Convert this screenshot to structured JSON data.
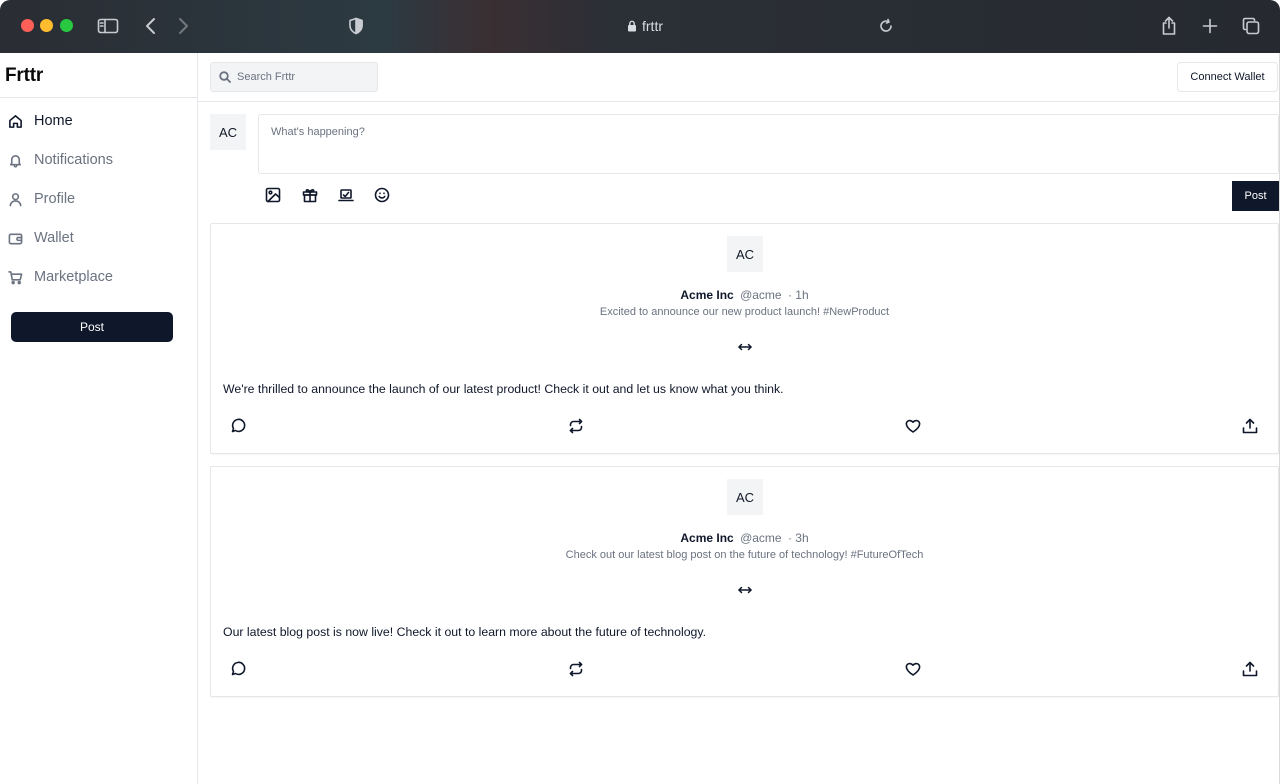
{
  "browser": {
    "url": "frttr",
    "icons": [
      "sidebar-toggle-icon",
      "back-icon",
      "forward-icon",
      "shield-icon",
      "lock-icon",
      "reload-icon",
      "share-icon",
      "new-tab-icon",
      "tabs-icon"
    ]
  },
  "sidebar": {
    "brand": "Frttr",
    "items": [
      {
        "label": "Home",
        "icon": "home-icon",
        "active": true
      },
      {
        "label": "Notifications",
        "icon": "bell-icon",
        "active": false
      },
      {
        "label": "Profile",
        "icon": "user-icon",
        "active": false
      },
      {
        "label": "Wallet",
        "icon": "wallet-icon",
        "active": false
      },
      {
        "label": "Marketplace",
        "icon": "cart-icon",
        "active": false
      }
    ],
    "post_button": "Post"
  },
  "header": {
    "search_placeholder": "Search Frttr",
    "connect_wallet": "Connect Wallet"
  },
  "composer": {
    "avatar": "AC",
    "placeholder": "What's happening?",
    "tools": [
      "image-icon",
      "gift-icon",
      "laptop-icon",
      "smile-icon"
    ],
    "post_button": "Post"
  },
  "posts": [
    {
      "avatar": "AC",
      "name": "Acme Inc",
      "handle": "@acme",
      "time": "· 1h",
      "subtitle": "Excited to announce our new product launch! #NewProduct",
      "body": "We're thrilled to announce the launch of our latest product! Check it out and let us know what you think."
    },
    {
      "avatar": "AC",
      "name": "Acme Inc",
      "handle": "@acme",
      "time": "· 3h",
      "subtitle": "Check out our latest blog post on the future of technology! #FutureOfTech",
      "body": "Our latest blog post is now live! Check it out to learn more about the future of technology."
    }
  ],
  "colors": {
    "primary": "#0f172a",
    "muted": "#6b7280",
    "border": "#e5e7eb",
    "avatar_bg": "#f3f4f6"
  }
}
